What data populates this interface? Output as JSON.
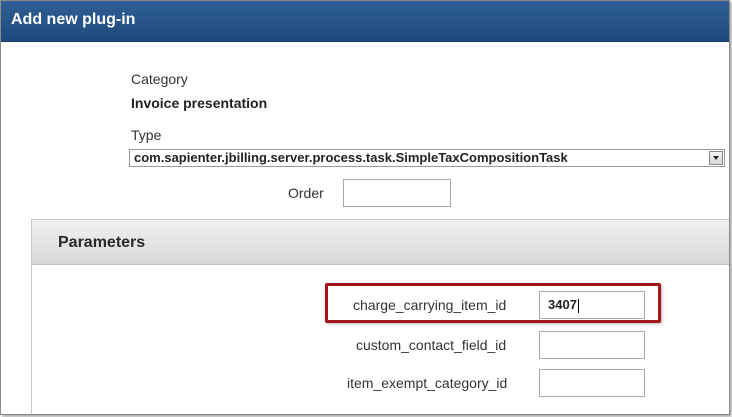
{
  "window": {
    "title": "Add new plug-in"
  },
  "form": {
    "category_label": "Category",
    "category_value": "Invoice presentation",
    "type_label": "Type",
    "type_value": "com.sapienter.jbilling.server.process.task.SimpleTaxCompositionTask",
    "order_label": "Order",
    "order_value": ""
  },
  "parameters": {
    "heading": "Parameters",
    "fields": [
      {
        "label": "charge_carrying_item_id",
        "value": "3407"
      },
      {
        "label": "custom_contact_field_id",
        "value": ""
      },
      {
        "label": "item_exempt_category_id",
        "value": ""
      }
    ]
  },
  "colors": {
    "title_bar": "#1e4a7c",
    "highlight": "#a01818"
  }
}
